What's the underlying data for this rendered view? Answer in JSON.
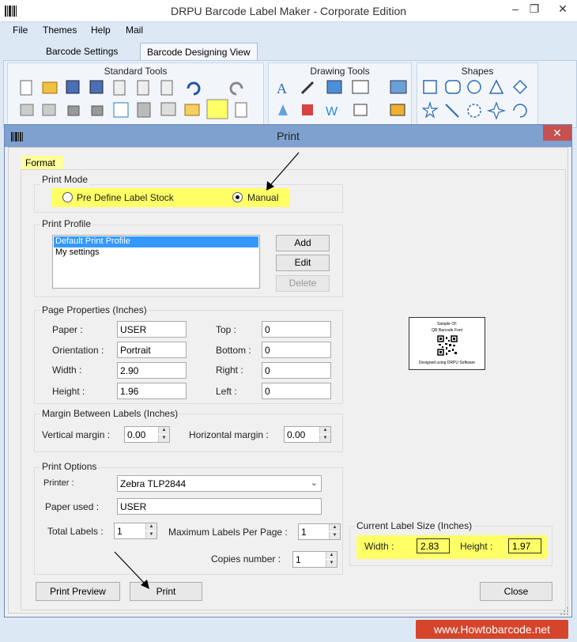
{
  "app": {
    "title": "DRPU Barcode Label Maker - Corporate Edition"
  },
  "menu": {
    "file": "File",
    "themes": "Themes",
    "help": "Help",
    "mail": "Mail"
  },
  "tabs": {
    "settings": "Barcode Settings",
    "designing": "Barcode Designing View"
  },
  "ribbon": {
    "standard": "Standard Tools",
    "drawing": "Drawing Tools",
    "shapes": "Shapes"
  },
  "dialog": {
    "title": "Print",
    "format_tab": "Format",
    "print_mode": {
      "label": "Print Mode",
      "option1": "Pre Define Label Stock",
      "option2": "Manual",
      "selected": "Manual"
    },
    "print_profile": {
      "label": "Print Profile",
      "items": [
        "Default Print Profile",
        "My settings"
      ],
      "add": "Add",
      "edit": "Edit",
      "delete": "Delete"
    },
    "page_properties": {
      "label": "Page Properties (Inches)",
      "paper_label": "Paper :",
      "paper": "USER",
      "orientation_label": "Orientation :",
      "orientation": "Portrait",
      "width_label": "Width :",
      "width": "2.90",
      "height_label": "Height :",
      "height": "1.96",
      "top_label": "Top :",
      "top": "0",
      "bottom_label": "Bottom :",
      "bottom": "0",
      "right_label": "Right :",
      "right": "0",
      "left_label": "Left :",
      "left": "0"
    },
    "margin": {
      "label": "Margin Between Labels (Inches)",
      "vertical_label": "Vertical margin :",
      "vertical": "0.00",
      "horizontal_label": "Horizontal margin :",
      "horizontal": "0.00"
    },
    "print_options": {
      "label": "Print Options",
      "printer_label": "Printer :",
      "printer": "Zebra TLP2844",
      "paper_used_label": "Paper used :",
      "paper_used": "USER",
      "total_labels_label": "Total Labels :",
      "total_labels": "1",
      "max_labels_label": "Maximum Labels Per Page :",
      "max_labels": "1",
      "copies_label": "Copies number :",
      "copies": "1"
    },
    "preview": {
      "line1": "Sample Of:",
      "line2": "QR Barcode Font",
      "line3": "Designed using DRPU Software"
    },
    "current_size": {
      "label": "Current Label Size (Inches)",
      "width_label": "Width :",
      "width": "2.83",
      "height_label": "Height :",
      "height": "1.97"
    },
    "buttons": {
      "preview": "Print Preview",
      "print": "Print",
      "close": "Close"
    }
  },
  "brand": "www.Howtobarcode.net",
  "colors": {
    "highlight": "#ffff66",
    "dialog_title": "#7ea1cf",
    "close": "#c75050"
  }
}
